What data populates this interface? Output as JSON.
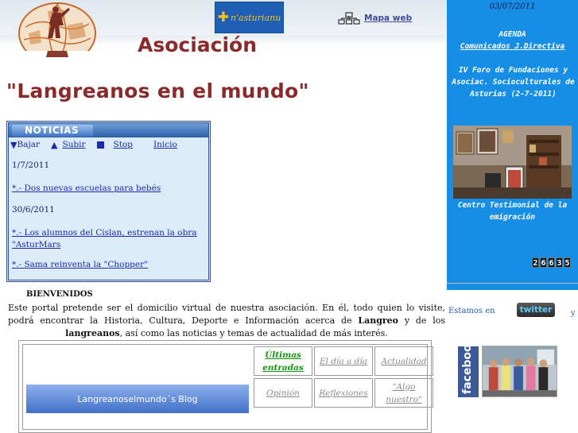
{
  "header": {
    "asturianu_badge": "n'asturianu",
    "asturianu_cross": "✚",
    "map_link": "Mapa web",
    "title_line1": "Asociación",
    "title_line2": "\"Langreanos en el mundo\""
  },
  "news": {
    "heading": "NOTICIAS",
    "controls": {
      "down": "Bajar",
      "up": "Subir",
      "stop": "Stop",
      "home": "Inicio"
    },
    "entries": [
      {
        "date": "1/7/2011"
      },
      {
        "item": "*.- Dos nuevas escuelas para bebés"
      },
      {
        "date": "30/6/2011"
      },
      {
        "item": "*.- Los alumnos del Cislan, estrenan la obra \"AsturMars"
      },
      {
        "item": "*.- Sama reinventa la \"Chopper\""
      }
    ]
  },
  "welcome": {
    "title": "BIENVENIDOS",
    "text_before_langreo": "Este portal pretende ser el domicilio virtual de nuestra asociación. En él, todo quien lo visite, podrá encontrar la Historia, Cultura, Deporte e Información acerca de ",
    "langreo": "Langreo",
    "text_mid": " y de los ",
    "langreanos": "langreanos",
    "text_after": ", así como las noticias y temas de actualidad de más interés."
  },
  "blog": {
    "banner": "Langreanoselmundo´s Blog",
    "cells": [
      "Últimas entradas",
      "El día a día",
      "Actualidad",
      "Opinión",
      "Reflexiones",
      "\"Algo nuestro\""
    ]
  },
  "sidebar": {
    "date": "03/07/2011",
    "agenda": "AGENDA",
    "comunicados": "Comunicados J.Directiva",
    "forum": "IV Foro de Fundaciones y Asociac. Socioculturales de Asturias (2-7-2011)",
    "caption": "Centro Testimonial de la emigración",
    "counter_digits": [
      "2",
      "6",
      "6",
      "3",
      "5"
    ]
  },
  "social": {
    "estamos": "Estamos en",
    "twitter": "twitter",
    "y": "y",
    "facebook": "facebook"
  },
  "colors": {
    "title": "#8b2a2a",
    "sidebar": "#178ee6",
    "news_bg": "#dcebf8",
    "link": "#1a2aa8",
    "green_link": "#129412"
  }
}
